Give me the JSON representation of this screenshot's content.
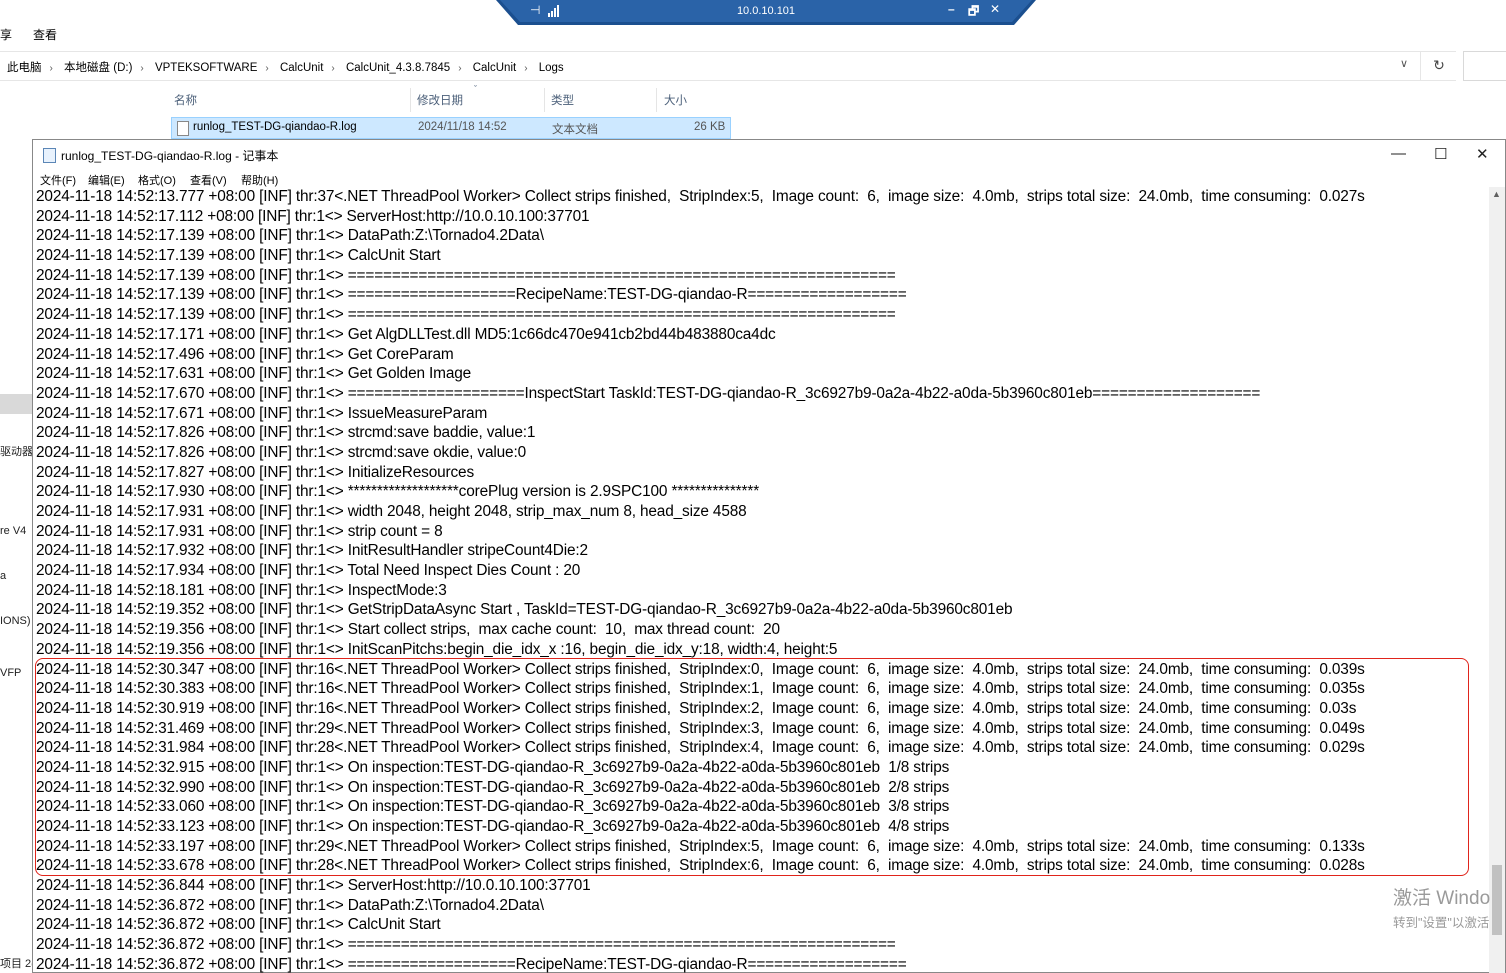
{
  "remote_desktop": {
    "host": "10.0.10.101",
    "pin_icon": "pin-icon",
    "minimize": "–",
    "restore": "🗗",
    "close": "✕"
  },
  "explorer": {
    "ribbon": {
      "tab_share": "享",
      "tab_view": "查看"
    },
    "breadcrumb": [
      "此电脑",
      "本地磁盘 (D:)",
      "VPTEKSOFTWARE",
      "CalcUnit",
      "CalcUnit_4.3.8.7845",
      "CalcUnit",
      "Logs"
    ],
    "columns": {
      "name": "名称",
      "modified": "修改日期",
      "type": "类型",
      "size": "大小"
    },
    "file": {
      "name": "runlog_TEST-DG-qiandao-R.log",
      "modified": "2024/11/18 14:52",
      "type": "文本文档",
      "size": "26 KB"
    },
    "left_fragments": [
      "驱动器",
      "re V4",
      "a",
      "IONS)",
      "VFP",
      "项目 2("
    ]
  },
  "notepad": {
    "title": "runlog_TEST-DG-qiandao-R.log - 记事本",
    "menu": [
      "文件(F)",
      "编辑(E)",
      "格式(O)",
      "查看(V)",
      "帮助(H)"
    ],
    "lines": [
      "2024-11-18 14:52:13.777 +08:00 [INF] thr:37<.NET ThreadPool Worker> Collect strips finished,  StripIndex:5,  Image count:  6,  image size:  4.0mb,  strips total size:  24.0mb,  time consuming:  0.027s",
      "2024-11-18 14:52:17.112 +08:00 [INF] thr:1<> ServerHost:http://10.0.10.100:37701",
      "2024-11-18 14:52:17.139 +08:00 [INF] thr:1<> DataPath:Z:\\Tornado4.2Data\\",
      "2024-11-18 14:52:17.139 +08:00 [INF] thr:1<> CalcUnit Start",
      "2024-11-18 14:52:17.139 +08:00 [INF] thr:1<> ==============================================================",
      "2024-11-18 14:52:17.139 +08:00 [INF] thr:1<> ===================RecipeName:TEST-DG-qiandao-R==================",
      "2024-11-18 14:52:17.139 +08:00 [INF] thr:1<> ==============================================================",
      "2024-11-18 14:52:17.171 +08:00 [INF] thr:1<> Get AlgDLLTest.dll MD5:1c66dc470e941cb2bd44b483880ca4dc",
      "2024-11-18 14:52:17.496 +08:00 [INF] thr:1<> Get CoreParam",
      "2024-11-18 14:52:17.631 +08:00 [INF] thr:1<> Get Golden Image",
      "2024-11-18 14:52:17.670 +08:00 [INF] thr:1<> ====================InspectStart TaskId:TEST-DG-qiandao-R_3c6927b9-0a2a-4b22-a0da-5b3960c801eb===================",
      "2024-11-18 14:52:17.671 +08:00 [INF] thr:1<> IssueMeasureParam",
      "2024-11-18 14:52:17.826 +08:00 [INF] thr:1<> strcmd:save baddie, value:1",
      "2024-11-18 14:52:17.826 +08:00 [INF] thr:1<> strcmd:save okdie, value:0",
      "2024-11-18 14:52:17.827 +08:00 [INF] thr:1<> InitializeResources",
      "2024-11-18 14:52:17.930 +08:00 [INF] thr:1<> *******************corePlug version is 2.9SPC100 ***************",
      "2024-11-18 14:52:17.931 +08:00 [INF] thr:1<> width 2048, height 2048, strip_max_num 8, head_size 4588",
      "2024-11-18 14:52:17.931 +08:00 [INF] thr:1<> strip count = 8",
      "2024-11-18 14:52:17.932 +08:00 [INF] thr:1<> InitResultHandler stripeCount4Die:2",
      "2024-11-18 14:52:17.934 +08:00 [INF] thr:1<> Total Need Inspect Dies Count : 20",
      "2024-11-18 14:52:18.181 +08:00 [INF] thr:1<> InspectMode:3",
      "2024-11-18 14:52:19.352 +08:00 [INF] thr:1<> GetStripDataAsync Start , TaskId=TEST-DG-qiandao-R_3c6927b9-0a2a-4b22-a0da-5b3960c801eb",
      "2024-11-18 14:52:19.356 +08:00 [INF] thr:1<> Start collect strips,  max cache count:  10,  max thread count:  20",
      "2024-11-18 14:52:19.356 +08:00 [INF] thr:1<> InitScanPitchs:begin_die_idx_x :16, begin_die_idx_y:18, width:4, height:5",
      "2024-11-18 14:52:30.347 +08:00 [INF] thr:16<.NET ThreadPool Worker> Collect strips finished,  StripIndex:0,  Image count:  6,  image size:  4.0mb,  strips total size:  24.0mb,  time consuming:  0.039s",
      "2024-11-18 14:52:30.383 +08:00 [INF] thr:16<.NET ThreadPool Worker> Collect strips finished,  StripIndex:1,  Image count:  6,  image size:  4.0mb,  strips total size:  24.0mb,  time consuming:  0.035s",
      "2024-11-18 14:52:30.919 +08:00 [INF] thr:16<.NET ThreadPool Worker> Collect strips finished,  StripIndex:2,  Image count:  6,  image size:  4.0mb,  strips total size:  24.0mb,  time consuming:  0.03s",
      "2024-11-18 14:52:31.469 +08:00 [INF] thr:29<.NET ThreadPool Worker> Collect strips finished,  StripIndex:3,  Image count:  6,  image size:  4.0mb,  strips total size:  24.0mb,  time consuming:  0.049s",
      "2024-11-18 14:52:31.984 +08:00 [INF] thr:28<.NET ThreadPool Worker> Collect strips finished,  StripIndex:4,  Image count:  6,  image size:  4.0mb,  strips total size:  24.0mb,  time consuming:  0.029s",
      "2024-11-18 14:52:32.915 +08:00 [INF] thr:1<> On inspection:TEST-DG-qiandao-R_3c6927b9-0a2a-4b22-a0da-5b3960c801eb  1/8 strips",
      "2024-11-18 14:52:32.990 +08:00 [INF] thr:1<> On inspection:TEST-DG-qiandao-R_3c6927b9-0a2a-4b22-a0da-5b3960c801eb  2/8 strips",
      "2024-11-18 14:52:33.060 +08:00 [INF] thr:1<> On inspection:TEST-DG-qiandao-R_3c6927b9-0a2a-4b22-a0da-5b3960c801eb  3/8 strips",
      "2024-11-18 14:52:33.123 +08:00 [INF] thr:1<> On inspection:TEST-DG-qiandao-R_3c6927b9-0a2a-4b22-a0da-5b3960c801eb  4/8 strips",
      "2024-11-18 14:52:33.197 +08:00 [INF] thr:29<.NET ThreadPool Worker> Collect strips finished,  StripIndex:5,  Image count:  6,  image size:  4.0mb,  strips total size:  24.0mb,  time consuming:  0.133s",
      "2024-11-18 14:52:33.678 +08:00 [INF] thr:28<.NET ThreadPool Worker> Collect strips finished,  StripIndex:6,  Image count:  6,  image size:  4.0mb,  strips total size:  24.0mb,  time consuming:  0.028s",
      "2024-11-18 14:52:36.844 +08:00 [INF] thr:1<> ServerHost:http://10.0.10.100:37701",
      "2024-11-18 14:52:36.872 +08:00 [INF] thr:1<> DataPath:Z:\\Tornado4.2Data\\",
      "2024-11-18 14:52:36.872 +08:00 [INF] thr:1<> CalcUnit Start",
      "2024-11-18 14:52:36.872 +08:00 [INF] thr:1<> ==============================================================",
      "2024-11-18 14:52:36.872 +08:00 [INF] thr:1<> ===================RecipeName:TEST-DG-qiandao-R=================="
    ]
  },
  "watermark": {
    "line1": "激活 Windo",
    "line2": "转到\"设置\"以激活"
  },
  "colors": {
    "rd_bar": "#1b4f8f",
    "highlight_border": "#e0241b",
    "selection": "#cde8ff"
  }
}
